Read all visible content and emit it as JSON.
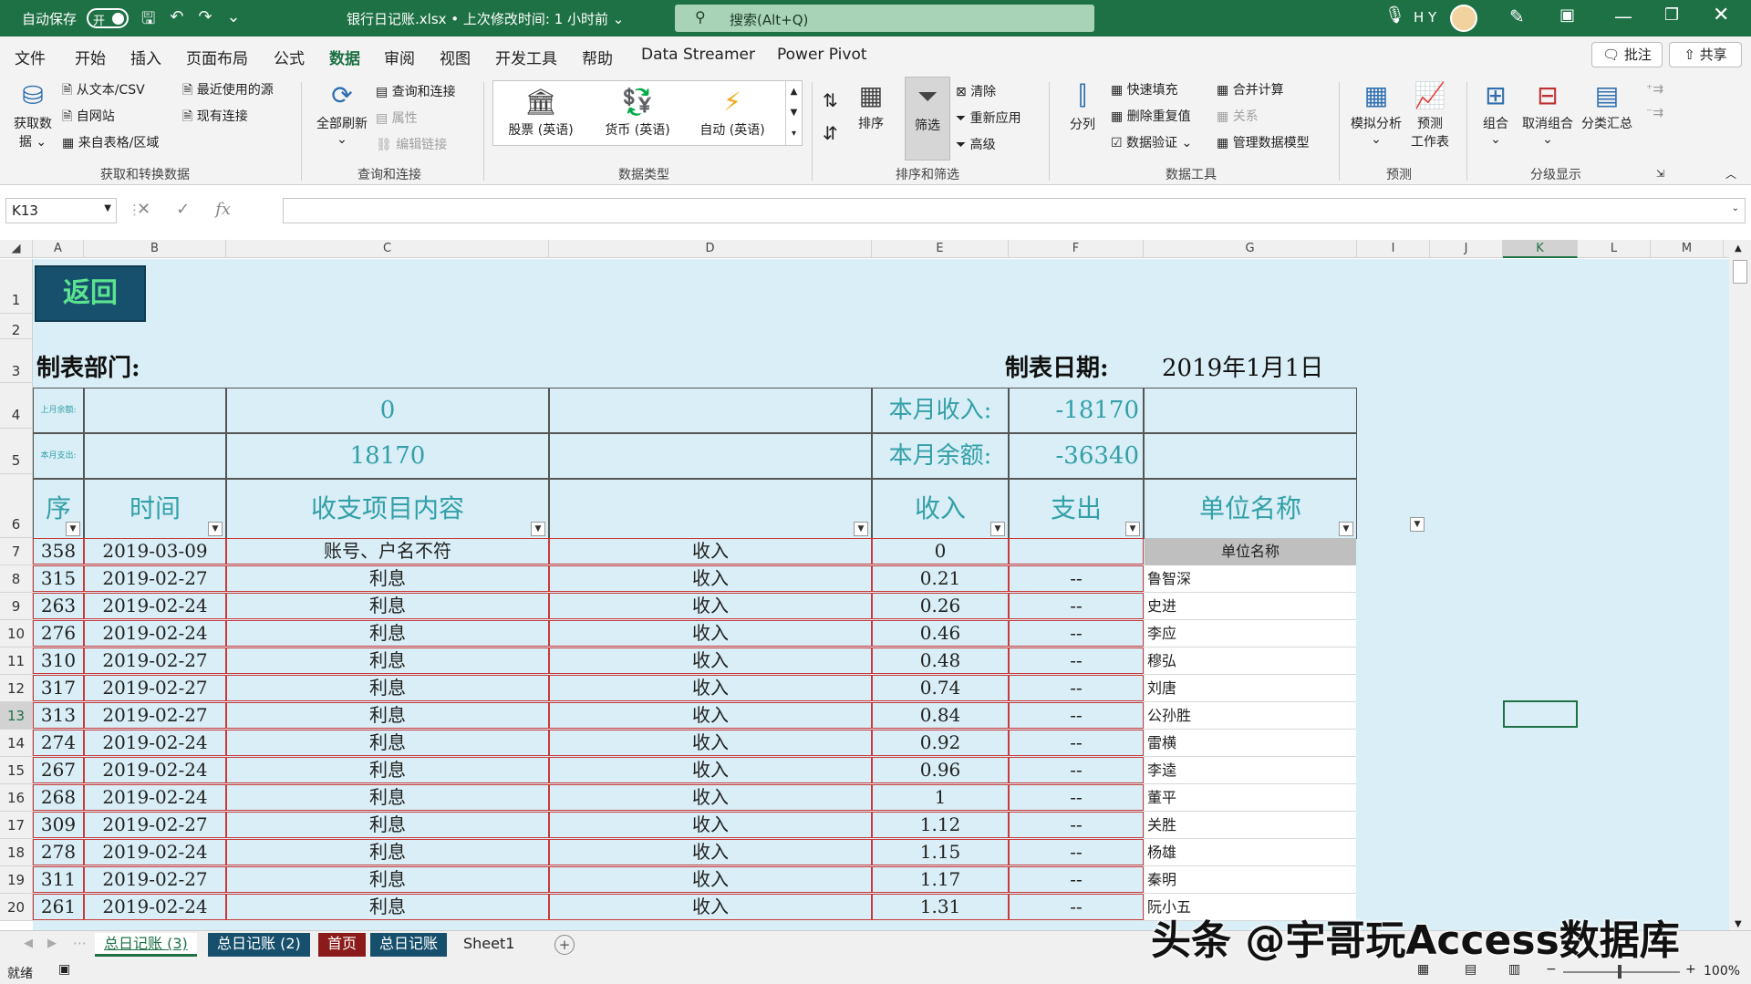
{
  "titlebar": {
    "autosave": "自动保存",
    "toggle": "开",
    "filename": "银行日记账.xlsx • 上次修改时间: 1 小时前 ⌄",
    "search": "搜索(Alt+Q)",
    "user": "H Y"
  },
  "menu": {
    "tabs": [
      "文件",
      "开始",
      "插入",
      "页面布局",
      "公式",
      "数据",
      "审阅",
      "视图",
      "开发工具",
      "帮助",
      "Data Streamer",
      "Power Pivot"
    ],
    "active": "数据",
    "comment": "批注",
    "share": "共享"
  },
  "ribbon": {
    "get_data": "获取数\n据 ⌄",
    "from_csv": "从文本/CSV",
    "from_web": "自网站",
    "from_table": "来自表格/区域",
    "recent": "最近使用的源",
    "existing": "现有连接",
    "group1": "获取和转换数据",
    "refresh_all": "全部刷新",
    "query_conn": "查询和连接",
    "props": "属性",
    "edit_links": "编辑链接",
    "group2": "查询和连接",
    "stocks": "股票 (英语)",
    "currency": "货币 (英语)",
    "auto": "自动 (英语)",
    "group3": "数据类型",
    "sort": "排序",
    "filter": "筛选",
    "clear": "清除",
    "reapply": "重新应用",
    "advanced": "高级",
    "group4": "排序和筛选",
    "split": "分列",
    "flash": "快速填充",
    "dedupe": "删除重复值",
    "validate": "数据验证",
    "consolidate": "合并计算",
    "relations": "关系",
    "model": "管理数据模型",
    "group5": "数据工具",
    "whatif": "模拟分析",
    "forecast": "预测\n工作表",
    "group6": "预测",
    "grp": "组合",
    "ungrp": "取消组合",
    "subtotal": "分类汇总",
    "group7": "分级显示"
  },
  "namebox": "K13",
  "columns": [
    "A",
    "B",
    "C",
    "D",
    "E",
    "F",
    "G",
    "I",
    "J",
    "K",
    "L",
    "M"
  ],
  "sheet": {
    "back": "返回",
    "dept_label": "制表部门:",
    "date_label": "制表日期:",
    "date_value": "2019年1月1日",
    "prev_balance_label": "上月余额:",
    "prev_balance": "0",
    "month_income_label": "本月收入:",
    "month_income": "-18170",
    "month_expense_label": "本月支出:",
    "month_expense": "18170",
    "month_balance_label": "本月余额:",
    "month_balance": "-36340",
    "headers": [
      "序号",
      "时间",
      "收支项目内容",
      "",
      "收入",
      "支出",
      "单位名称"
    ],
    "unit_header": "单位名称",
    "rows": [
      [
        "358",
        "2019-03-09",
        "账号、户名不符",
        "收入",
        "0",
        "",
        ""
      ],
      [
        "315",
        "2019-02-27",
        "利息",
        "收入",
        "0.21",
        "--",
        "鲁智深"
      ],
      [
        "263",
        "2019-02-24",
        "利息",
        "收入",
        "0.26",
        "--",
        "史进"
      ],
      [
        "276",
        "2019-02-24",
        "利息",
        "收入",
        "0.46",
        "--",
        "李应"
      ],
      [
        "310",
        "2019-02-27",
        "利息",
        "收入",
        "0.48",
        "--",
        "穆弘"
      ],
      [
        "317",
        "2019-02-27",
        "利息",
        "收入",
        "0.74",
        "--",
        "刘唐"
      ],
      [
        "313",
        "2019-02-27",
        "利息",
        "收入",
        "0.84",
        "--",
        "公孙胜"
      ],
      [
        "274",
        "2019-02-24",
        "利息",
        "收入",
        "0.92",
        "--",
        "雷横"
      ],
      [
        "267",
        "2019-02-24",
        "利息",
        "收入",
        "0.96",
        "--",
        "李逵"
      ],
      [
        "268",
        "2019-02-24",
        "利息",
        "收入",
        "1",
        "--",
        "董平"
      ],
      [
        "309",
        "2019-02-27",
        "利息",
        "收入",
        "1.12",
        "--",
        "关胜"
      ],
      [
        "278",
        "2019-02-24",
        "利息",
        "收入",
        "1.15",
        "--",
        "杨雄"
      ],
      [
        "311",
        "2019-02-27",
        "利息",
        "收入",
        "1.17",
        "--",
        "秦明"
      ],
      [
        "261",
        "2019-02-24",
        "利息",
        "收入",
        "1.31",
        "--",
        "阮小五"
      ]
    ],
    "row_numbers": [
      "1",
      "2",
      "3",
      "4",
      "5",
      "6",
      "7",
      "8",
      "9",
      "10",
      "11",
      "12",
      "13",
      "14",
      "15",
      "16",
      "17",
      "18",
      "19",
      "20"
    ]
  },
  "sheet_tabs": [
    "总日记账 (3)",
    "总日记账 (2)",
    "首页",
    "总日记账",
    "Sheet1"
  ],
  "status": {
    "ready": "就绪",
    "zoom": "100%"
  },
  "watermark": "头条 @宇哥玩Access数据库"
}
